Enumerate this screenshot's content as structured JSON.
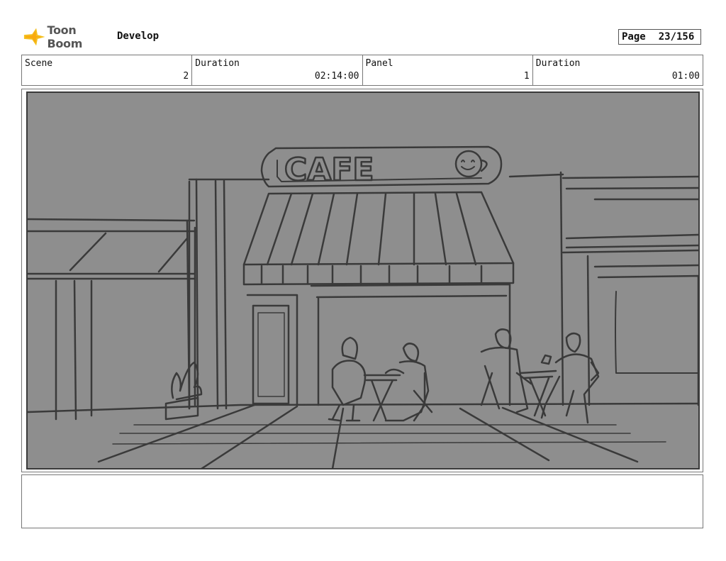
{
  "header": {
    "logo_text": "Toon Boom",
    "project": "Develop",
    "page_label": "Page",
    "page_value": "23/156"
  },
  "info": {
    "scene_label": "Scene",
    "scene_value": "2",
    "scene_duration_label": "Duration",
    "scene_duration_value": "02:14:00",
    "panel_label": "Panel",
    "panel_value": "1",
    "panel_duration_label": "Duration",
    "panel_duration_value": "01:00"
  },
  "sketch": {
    "sign_text": "CAFE",
    "background_color": "#8e8e8e",
    "line_color": "#3a3a3a"
  },
  "notes": {
    "text": ""
  }
}
